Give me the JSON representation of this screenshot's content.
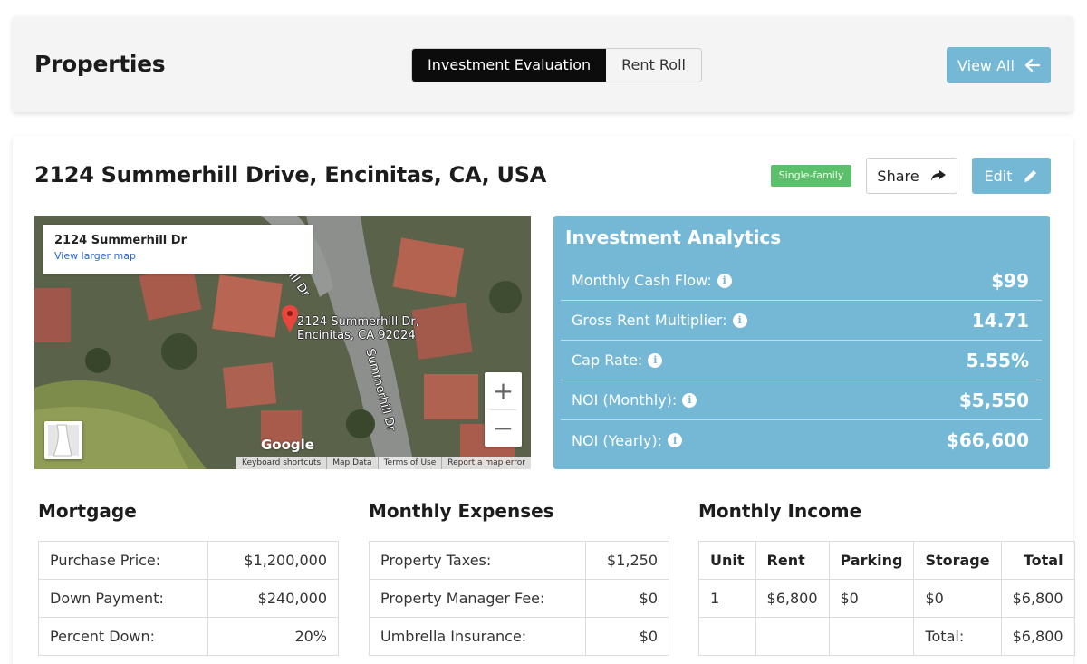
{
  "header": {
    "title": "Properties",
    "tabs": [
      {
        "label": "Investment Evaluation",
        "active": true
      },
      {
        "label": "Rent Roll",
        "active": false
      }
    ],
    "view_all_label": "View All"
  },
  "property": {
    "address": "2124 Summerhill Drive, Encinitas, CA, USA",
    "type_badge": "Single-family",
    "share_label": "Share",
    "edit_label": "Edit"
  },
  "map": {
    "info_title": "2124 Summerhill Dr",
    "info_link": "View larger map",
    "pin_label_line1": "2124 Summerhill Dr,",
    "pin_label_line2": "Encinitas, CA 92024",
    "street_label": "Summerhill Dr",
    "street_label_2": "erhill Dr",
    "provider": "Google",
    "footer": [
      "Keyboard shortcuts",
      "Map Data",
      "Terms of Use",
      "Report a map error"
    ]
  },
  "analytics": {
    "title": "Investment Analytics",
    "rows": [
      {
        "label": "Monthly Cash Flow:",
        "value": "$99"
      },
      {
        "label": "Gross Rent Multiplier:",
        "value": "14.71"
      },
      {
        "label": "Cap Rate:",
        "value": "5.55%"
      },
      {
        "label": "NOI (Monthly):",
        "value": "$5,550"
      },
      {
        "label": "NOI (Yearly):",
        "value": "$66,600"
      }
    ]
  },
  "mortgage": {
    "title": "Mortgage",
    "rows": [
      {
        "label": "Purchase Price:",
        "value": "$1,200,000"
      },
      {
        "label": "Down Payment:",
        "value": "$240,000"
      },
      {
        "label": "Percent Down:",
        "value": "20%"
      }
    ]
  },
  "expenses": {
    "title": "Monthly Expenses",
    "rows": [
      {
        "label": "Property Taxes:",
        "value": "$1,250"
      },
      {
        "label": "Property Manager Fee:",
        "value": "$0"
      },
      {
        "label": "Umbrella Insurance:",
        "value": "$0"
      }
    ]
  },
  "income": {
    "title": "Monthly Income",
    "headers": [
      "Unit",
      "Rent",
      "Parking",
      "Storage",
      "Total"
    ],
    "rows": [
      [
        "1",
        "$6,800",
        "$0",
        "$0",
        "$6,800"
      ],
      [
        "",
        "",
        "",
        "Total:",
        "$6,800"
      ]
    ]
  },
  "colors": {
    "accent_blue": "#74b8d6",
    "badge_green": "#5cbf6b",
    "active_tab": "#0c0c0c"
  }
}
